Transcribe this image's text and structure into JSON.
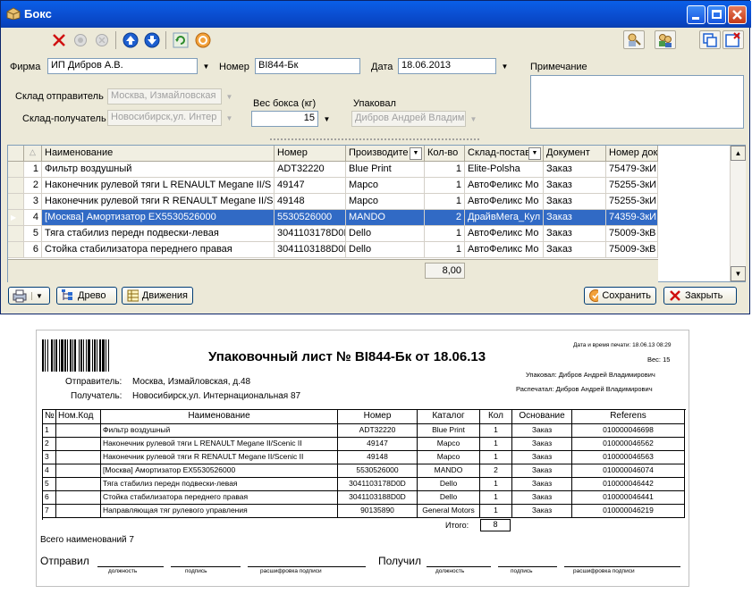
{
  "window": {
    "title": "Бокс",
    "colors": {
      "titlebar": "#0a52d6",
      "selection": "#316ac5",
      "body": "#ece9d8"
    }
  },
  "form": {
    "firma_label": "Фирма",
    "firma_value": "ИП Дибров А.В.",
    "nomer_label": "Номер",
    "nomer_value": "BI844-Бк",
    "data_label": "Дата",
    "data_value": "18.06.2013",
    "primechanie_label": "Примечание",
    "sklad_otpr_label": "Склад отправитель",
    "sklad_otpr_value": "Москва, Измайловская",
    "sklad_pol_label": "Склад-получатель",
    "sklad_pol_value": "Новосибирск,ул. Интер",
    "ves_label": "Вес бокса (кг)",
    "ves_value": "15",
    "upakoval_label": "Упаковал",
    "upakoval_value": "Дибров Андрей Владим"
  },
  "grid": {
    "headers": [
      "Наименование",
      "Номер",
      "Производите",
      "Кол-во",
      "Склад-постав",
      "Документ",
      "Номер док"
    ],
    "rows": [
      {
        "n": "1",
        "name": "Фильтр воздушный",
        "nomer": "ADT32220",
        "prod": "Blue Print",
        "qty": "1",
        "sklad": "Elite-Polsha",
        "doc": "Заказ",
        "docnum": "75479-3кИ"
      },
      {
        "n": "2",
        "name": "Наконечник рулевой тяги L RENAULT Megane II/S",
        "nomer": "49147",
        "prod": "Mapco",
        "qty": "1",
        "sklad": "АвтоФеликс Мо",
        "doc": "Заказ",
        "docnum": "75255-3кИ"
      },
      {
        "n": "3",
        "name": "Наконечник рулевой тяги R RENAULT Megane II/S",
        "nomer": "49148",
        "prod": "Mapco",
        "qty": "1",
        "sklad": "АвтоФеликс Мо",
        "doc": "Заказ",
        "docnum": "75255-3кИ"
      },
      {
        "n": "4",
        "name": "[Москва] Амортизатор EX5530526000",
        "nomer": "5530526000",
        "prod": "MANDO",
        "qty": "2",
        "sklad": "ДрайвМега_Кул",
        "doc": "Заказ",
        "docnum": "74359-3кИ"
      },
      {
        "n": "5",
        "name": "Тяга стабилиз передн подвески-левая",
        "nomer": "3041103178D0I",
        "prod": "Dello",
        "qty": "1",
        "sklad": "АвтоФеликс Мо",
        "doc": "Заказ",
        "docnum": "75009-3кВ"
      },
      {
        "n": "6",
        "name": "Стойка стабилизатора переднего правая",
        "nomer": "3041103188D0I",
        "prod": "Dello",
        "qty": "1",
        "sklad": "АвтоФеликс Мо",
        "doc": "Заказ",
        "docnum": "75009-3кВ"
      }
    ],
    "total": "8,00"
  },
  "buttons": {
    "drevo": "Древо",
    "dvizheniya": "Движения",
    "sohranit": "Сохранить",
    "zakryt": "Закрыть"
  },
  "report": {
    "title": "Упаковочный лист № BI844-Бк от 18.06.13",
    "print_time": "Дата и время печати: 18.06.13 08:29",
    "ves": "Вес: 15",
    "upakoval": "Упаковал: Дибров Андрей Владимирович",
    "raspechatal": "Распечатал: Дибров Андрей Владимирович",
    "otpravitel_label": "Отправитель:",
    "otpravitel": "Москва, Измайловская, д.48",
    "poluchatel_label": "Получатель:",
    "poluchatel": "Новосибирск,ул. Интернациональная 87",
    "headers": [
      "№",
      "Ном.Код",
      "Наименование",
      "Номер",
      "Каталог",
      "Кол",
      "Основание",
      "Referens"
    ],
    "rows": [
      {
        "n": "1",
        "name": "Фильтр воздушный",
        "nomer": "ADT32220",
        "cat": "Blue Print",
        "qty": "1",
        "osn": "Заказ",
        "ref": "010000046698"
      },
      {
        "n": "2",
        "name": "Наконечник рулевой тяги L RENAULT Megane II/Scenic II",
        "nomer": "49147",
        "cat": "Mapco",
        "qty": "1",
        "osn": "Заказ",
        "ref": "010000046562"
      },
      {
        "n": "3",
        "name": "Наконечник рулевой тяги R RENAULT Megane II/Scenic II",
        "nomer": "49148",
        "cat": "Mapco",
        "qty": "1",
        "osn": "Заказ",
        "ref": "010000046563"
      },
      {
        "n": "4",
        "name": "[Москва] Амортизатор EX5530526000",
        "nomer": "5530526000",
        "cat": "MANDO",
        "qty": "2",
        "osn": "Заказ",
        "ref": "010000046074"
      },
      {
        "n": "5",
        "name": "Тяга стабилиз передн подвески-левая",
        "nomer": "3041103178D0D",
        "cat": "Dello",
        "qty": "1",
        "osn": "Заказ",
        "ref": "010000046442"
      },
      {
        "n": "6",
        "name": "Стойка стабилизатора переднего правая",
        "nomer": "3041103188D0D",
        "cat": "Dello",
        "qty": "1",
        "osn": "Заказ",
        "ref": "010000046441"
      },
      {
        "n": "7",
        "name": "Направляющая тяг рулевого управления",
        "nomer": "90135890",
        "cat": "General Motors",
        "qty": "1",
        "osn": "Заказ",
        "ref": "010000046219"
      }
    ],
    "itogo_label": "Итого:",
    "itogo": "8",
    "vsego": "Всего наименований 7",
    "otpravil": "Отправил",
    "poluchil": "Получил",
    "dolzhnost": "должность",
    "podpis": "подпись",
    "rasshifrovka": "расшифровка подписи"
  }
}
